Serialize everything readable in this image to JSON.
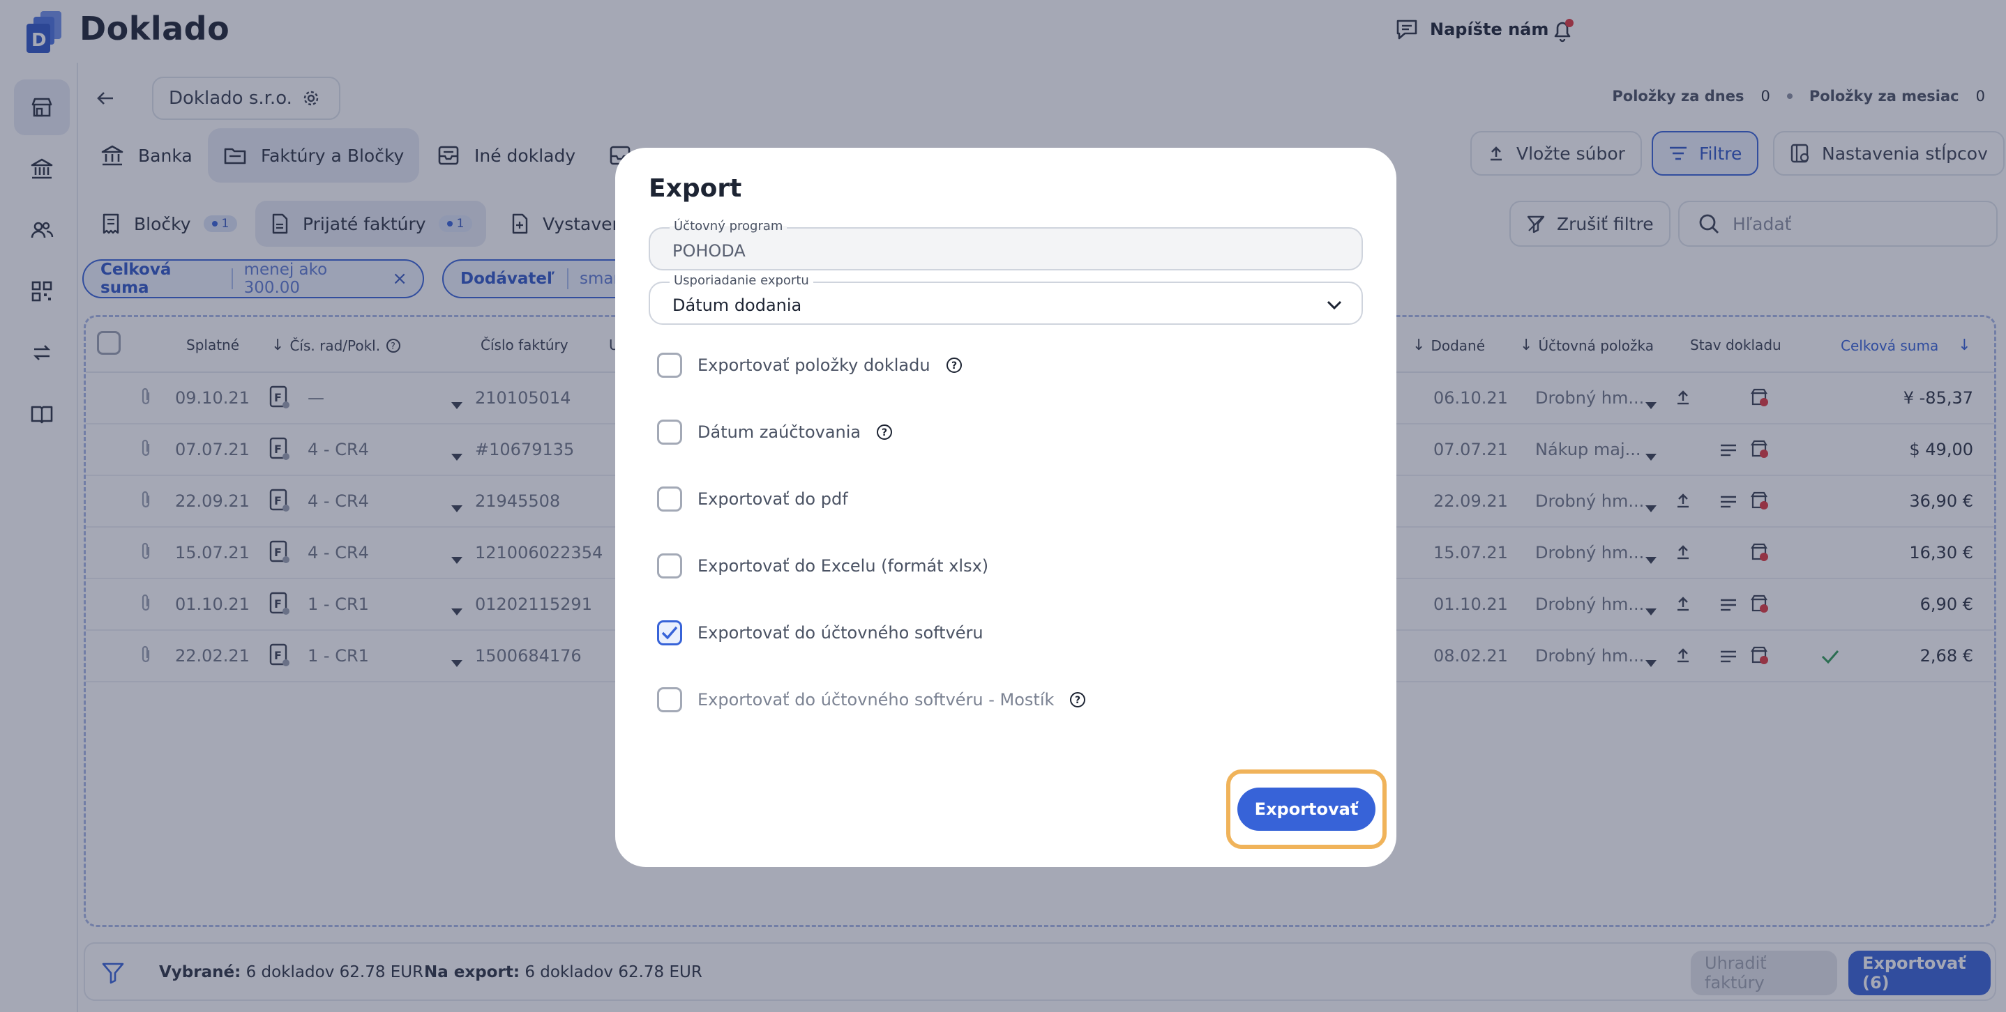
{
  "header": {
    "app_name": "Doklado",
    "contact_label": "Napíšte nám"
  },
  "sidebar": {
    "items": [
      "store-icon",
      "bank-icon",
      "users-icon",
      "qr-icon",
      "transfer-icon",
      "book-icon"
    ]
  },
  "breadcrumb": {
    "company": "Doklado s.r.o."
  },
  "counters": {
    "today_label": "Položky za dnes",
    "today_value": "0",
    "month_label": "Položky za mesiac",
    "month_value": "0"
  },
  "main_tabs": [
    {
      "label": "Banka"
    },
    {
      "label": "Faktúry a Bločky"
    },
    {
      "label": "Iné doklady"
    }
  ],
  "toolbar": {
    "upload_label": "Vložte súbor",
    "filters_label": "Filtre",
    "columns_label": "Nastavenia stĺpcov",
    "clear_filters_label": "Zrušiť filtre",
    "search_placeholder": "Hľadať"
  },
  "sub_tabs": [
    {
      "label": "Bločky",
      "count": "1"
    },
    {
      "label": "Prijaté faktúry",
      "count": "1"
    },
    {
      "label": "Vystaven"
    }
  ],
  "filter_chips": [
    {
      "key": "Celková suma",
      "value": "menej ako 300.00"
    },
    {
      "key": "Dodávateľ",
      "value": "smartn"
    }
  ],
  "table": {
    "headers": {
      "due": "Splatné",
      "series": "Čís. rad/Pokl.",
      "invoice_no": "Číslo faktúry",
      "u": "U",
      "delivered": "Dodané",
      "account_item": "Účtovná položka",
      "status": "Stav dokladu",
      "total": "Celková suma"
    },
    "rows": [
      {
        "due": "09.10.21",
        "series": "—",
        "invoice": "210105014",
        "delivered": "06.10.21",
        "item": "Drobný hm...",
        "total": "¥ -85,37"
      },
      {
        "due": "07.07.21",
        "series": "4 - CR4",
        "invoice": "#10679135",
        "delivered": "07.07.21",
        "item": "Nákup  maj...",
        "total": "$ 49,00"
      },
      {
        "due": "22.09.21",
        "series": "4 - CR4",
        "invoice": "21945508",
        "delivered": "22.09.21",
        "item": "Drobný hm...",
        "total": "36,90 €"
      },
      {
        "due": "15.07.21",
        "series": "4 - CR4",
        "invoice": "121006022354",
        "delivered": "15.07.21",
        "item": "Drobný hm...",
        "total": "16,30 €"
      },
      {
        "due": "01.10.21",
        "series": "1 - CR1",
        "invoice": "01202115291",
        "delivered": "01.10.21",
        "item": "Drobný hm...",
        "total": "6,90 €"
      },
      {
        "due": "22.02.21",
        "series": "1 - CR1",
        "invoice": "1500684176",
        "delivered": "08.02.21",
        "item": "Drobný hm...",
        "total": "2,68 €"
      }
    ]
  },
  "footer": {
    "selected_label": "Vybrané:",
    "selected_value": "6 dokladov 62.78 EUR",
    "export_label": "Na export:",
    "export_value": "6 dokladov 62.78 EUR",
    "pay_label": "Uhradiť faktúry",
    "export_button": "Exportovať (6)"
  },
  "modal": {
    "title": "Export",
    "program_label": "Účtovný program",
    "program_value": "POHODA",
    "order_label": "Usporiadanie exportu",
    "order_value": "Dátum dodania",
    "options": [
      {
        "label": "Exportovať položky dokladu",
        "checked": false
      },
      {
        "label": "Dátum zaúčtovania",
        "checked": false
      },
      {
        "label": "Exportovať do pdf",
        "checked": false
      },
      {
        "label": "Exportovať do Excelu (formát xlsx)",
        "checked": false
      },
      {
        "label": "Exportovať do účtovného softvéru",
        "checked": true
      },
      {
        "label": "Exportovať do účtovného softvéru - Mostík",
        "checked": false
      }
    ],
    "submit_label": "Exportovať"
  },
  "colors": {
    "accent": "#3763d8",
    "highlight": "#f0b35a",
    "overlay": "#28304e"
  }
}
